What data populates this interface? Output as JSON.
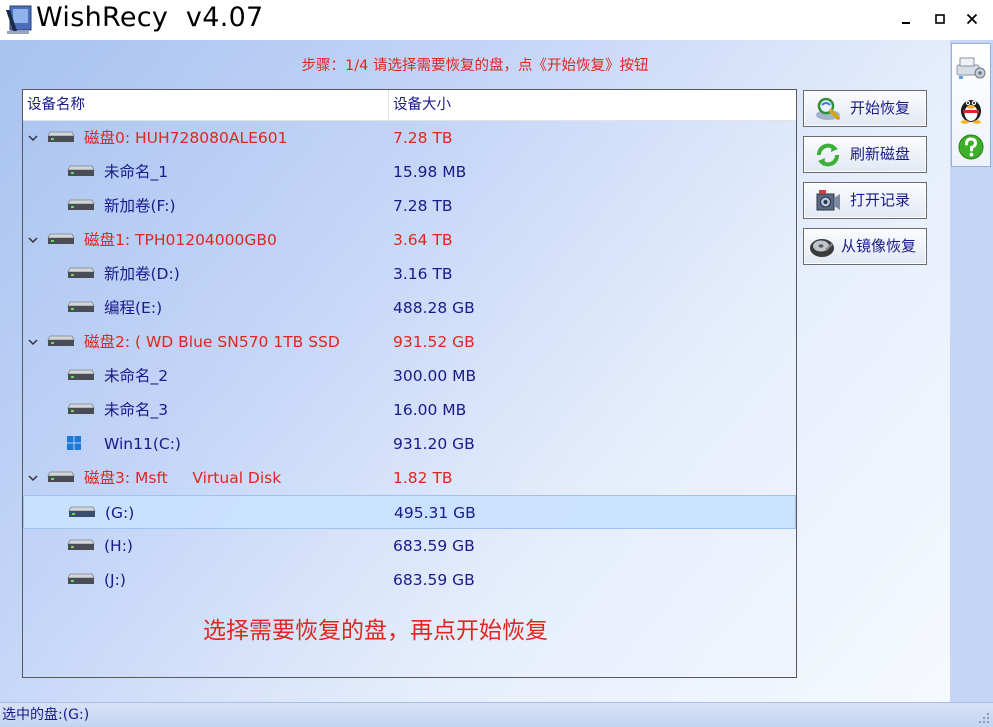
{
  "window": {
    "title": "WishRecy  v4.07"
  },
  "step_text": "步骤：1/4 请选择需要恢复的盘，点《开始恢复》按钮",
  "list": {
    "headers": {
      "name": "设备名称",
      "size": "设备大小"
    },
    "rows": [
      {
        "name": "磁盘0: HUH728080ALE601",
        "size": "7.28 TB",
        "kind": "disk"
      },
      {
        "name": "未命名_1",
        "size": "15.98 MB",
        "kind": "partition"
      },
      {
        "name": "新加卷(F:)",
        "size": "7.28 TB",
        "kind": "partition"
      },
      {
        "name": "磁盘1: TPH01204000GB0",
        "size": "3.64 TB",
        "kind": "disk"
      },
      {
        "name": "新加卷(D:)",
        "size": "3.16 TB",
        "kind": "partition"
      },
      {
        "name": "编程(E:)",
        "size": "488.28 GB",
        "kind": "partition"
      },
      {
        "name": "磁盘2: ( WD Blue SN570 1TB SSD",
        "size": "931.52 GB",
        "kind": "disk"
      },
      {
        "name": "未命名_2",
        "size": "300.00 MB",
        "kind": "partition"
      },
      {
        "name": "未命名_3",
        "size": "16.00 MB",
        "kind": "partition"
      },
      {
        "name": "Win11(C:)",
        "size": "931.20 GB",
        "kind": "windows"
      },
      {
        "name": "磁盘3: Msft     Virtual Disk",
        "size": "1.82 TB",
        "kind": "disk"
      },
      {
        "name": "(G:)",
        "size": "495.31 GB",
        "kind": "partition",
        "selected": true
      },
      {
        "name": "(H:)",
        "size": "683.59 GB",
        "kind": "partition"
      },
      {
        "name": "(J:)",
        "size": "683.59 GB",
        "kind": "partition"
      }
    ]
  },
  "hint_text": "选择需要恢复的盘，再点开始恢复",
  "buttons": {
    "start": "开始恢复",
    "refresh": "刷新磁盘",
    "open_log": "打开记录",
    "from_image": "从镜像恢复"
  },
  "status": {
    "selected_disk": "选中的盘:(G:)"
  },
  "colors": {
    "accent_red": "#e0261f",
    "text_blue": "#1a1a8a",
    "selection": "#c8e1ff"
  }
}
